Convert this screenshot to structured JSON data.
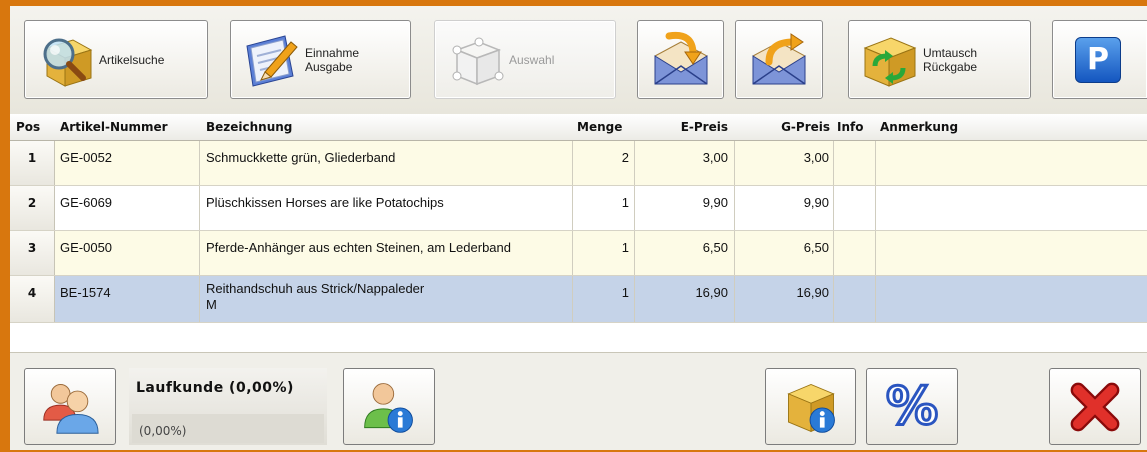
{
  "toolbar": {
    "artikelsuche": "Artikelsuche",
    "einnahme_line1": "Einnahme",
    "einnahme_line2": "Ausgabe",
    "auswahl": "Auswahl",
    "umtausch_line1": "Umtausch",
    "umtausch_line2": "Rückgabe",
    "parking_label": "P"
  },
  "table": {
    "columns": [
      "Pos",
      "Artikel-Nummer",
      "Bezeichnung",
      "Menge",
      "E-Preis",
      "G-Preis",
      "Info",
      "Anmerkung"
    ],
    "rows": [
      {
        "pos": "1",
        "nummer": "GE-0052",
        "bezeichnung": "Schmuckkette grün, Gliederband",
        "bezeichnung2": "",
        "menge": "2",
        "epreis": "3,00",
        "gpreis": "3,00",
        "info": "",
        "anmerkung": ""
      },
      {
        "pos": "2",
        "nummer": "GE-6069",
        "bezeichnung": "Plüschkissen Horses are like Potatochips",
        "bezeichnung2": "",
        "menge": "1",
        "epreis": "9,90",
        "gpreis": "9,90",
        "info": "",
        "anmerkung": ""
      },
      {
        "pos": "3",
        "nummer": "GE-0050",
        "bezeichnung": "Pferde-Anhänger aus echten Steinen, am Lederband",
        "bezeichnung2": "",
        "menge": "1",
        "epreis": "6,50",
        "gpreis": "6,50",
        "info": "",
        "anmerkung": ""
      },
      {
        "pos": "4",
        "nummer": "BE-1574",
        "bezeichnung": "Reithandschuh aus Strick/Nappaleder",
        "bezeichnung2": "M",
        "menge": "1",
        "epreis": "16,90",
        "gpreis": "16,90",
        "info": "",
        "anmerkung": ""
      }
    ]
  },
  "customer": {
    "name": "Laufkunde  (0,00%)",
    "discount": "(0,00%)"
  },
  "bottom": {
    "percent_label": "%"
  },
  "colors": {
    "frame": "#d8770e",
    "row_odd": "#fdfbe6",
    "row_even": "#ffffff",
    "row_selected": "#c5d3e8"
  }
}
